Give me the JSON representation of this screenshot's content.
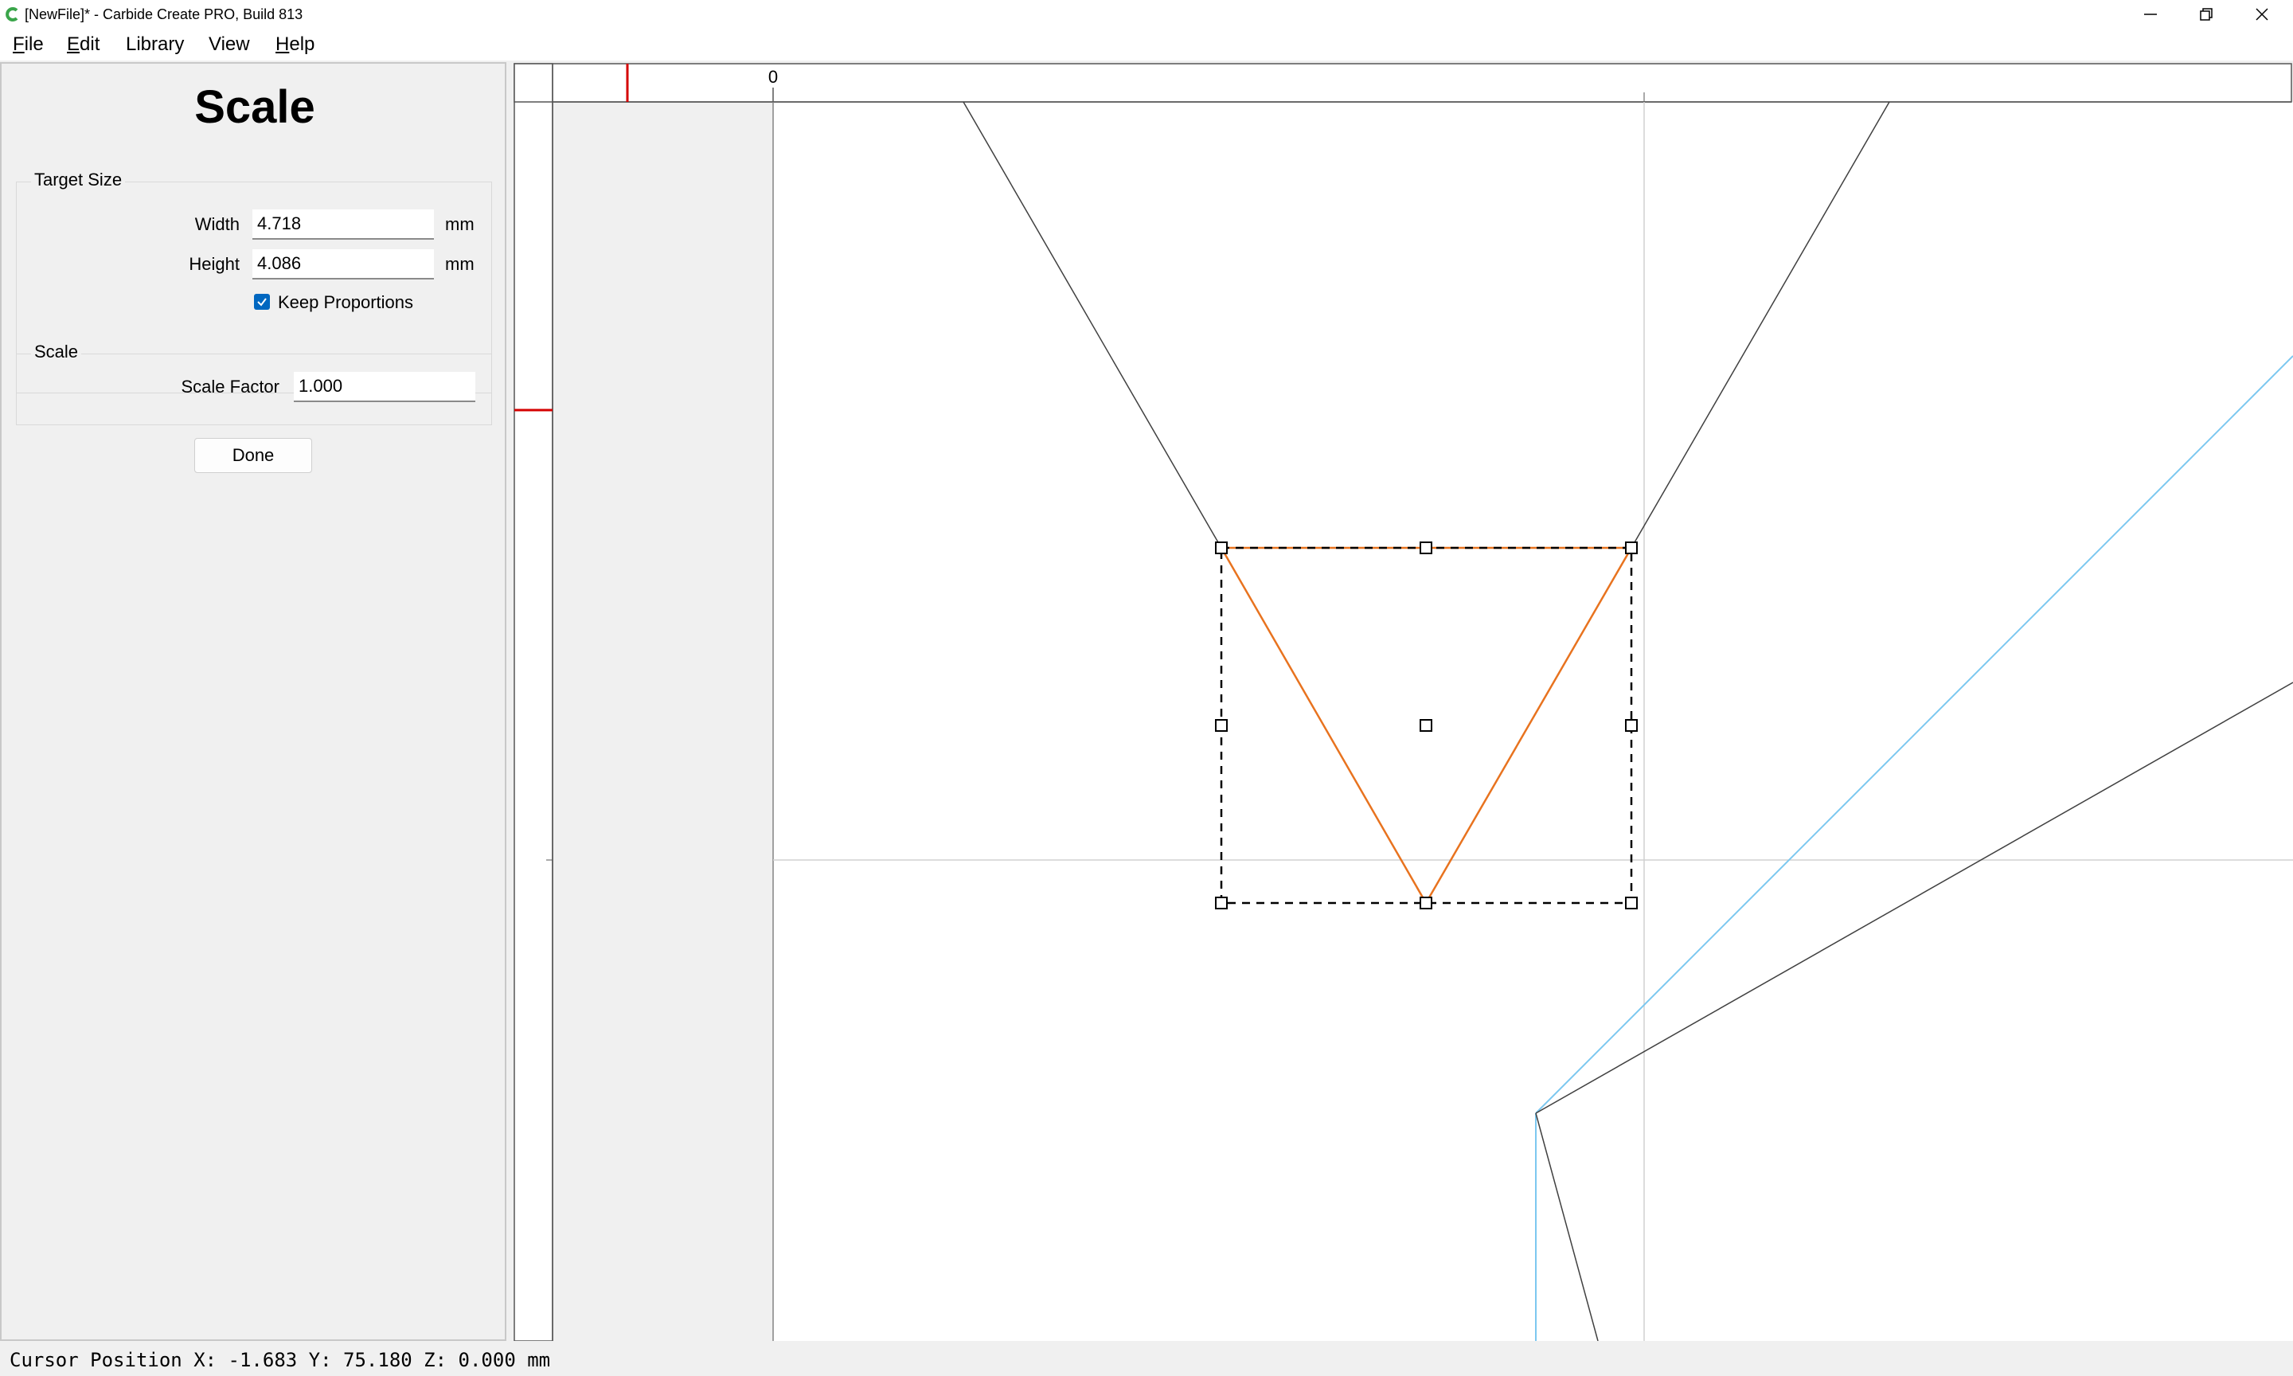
{
  "window": {
    "title": "[NewFile]* - Carbide Create PRO, Build 813",
    "icon": "carbide-create-logo-icon",
    "controls": [
      "minimize-icon",
      "restore-icon",
      "close-icon"
    ]
  },
  "menu": {
    "items": [
      {
        "label": "File",
        "accel": "F",
        "rest": "ile"
      },
      {
        "label": "Edit",
        "accel": "E",
        "rest": "dit"
      },
      {
        "label": "Library",
        "accel": "",
        "rest": "Library"
      },
      {
        "label": "View",
        "accel": "",
        "rest": "View"
      },
      {
        "label": "Help",
        "accel": "H",
        "rest": "elp"
      }
    ]
  },
  "panel": {
    "title": "Scale",
    "target_size": {
      "group_label": "Target Size",
      "width_label": "Width",
      "width_value": "4.718",
      "width_unit": "mm",
      "height_label": "Height",
      "height_value": "4.086",
      "height_unit": "mm",
      "keep_proportions_label": "Keep Proportions",
      "keep_proportions_checked": true
    },
    "scale": {
      "group_label": "Scale",
      "factor_label": "Scale Factor",
      "factor_value": "1.000"
    },
    "done_label": "Done"
  },
  "canvas": {
    "ruler_origin_label": "0",
    "colors": {
      "selected_shape": "#e8731f",
      "toolpath": "#7cc8f0",
      "geometry": "#404040",
      "cursor_marker": "#d40000"
    }
  },
  "status": {
    "text": "Cursor Position X: -1.683 Y: 75.180 Z: 0.000 mm"
  }
}
